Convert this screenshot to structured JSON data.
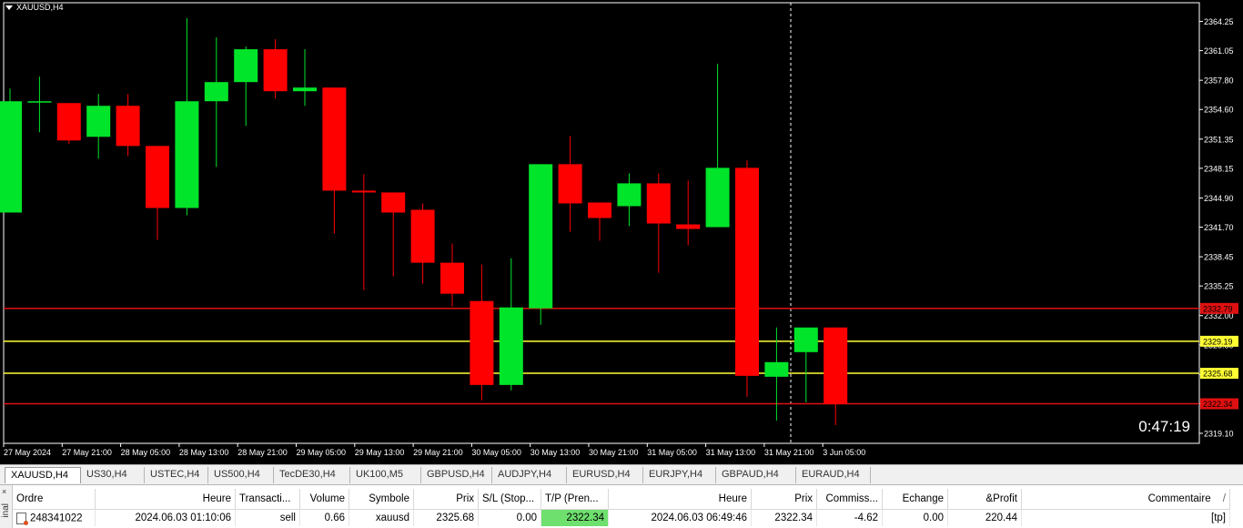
{
  "chart": {
    "symbol_label": "XAUUSD,H4",
    "timer": "0:47:19",
    "colors": {
      "bg": "#000000",
      "bull": "#00e52a",
      "bear": "#ff0000",
      "axis": "#ffffff",
      "sl_line": "#e01010",
      "entry_line": "#ffff33",
      "crosshair": "#ffffff"
    }
  },
  "chart_data": {
    "type": "candlestick",
    "symbol": "XAUUSD",
    "timeframe": "H4",
    "ylim": [
      2318.0,
      2366.3
    ],
    "y_ticks": [
      "2364.25",
      "2361.05",
      "2357.80",
      "2354.60",
      "2351.35",
      "2348.15",
      "2344.90",
      "2341.70",
      "2338.45",
      "2335.25",
      "2332.00",
      "2328.80",
      "2325.55",
      "2322.35",
      "2319.10"
    ],
    "x_labels": [
      "27 May 2024",
      "27 May 21:00",
      "28 May 05:00",
      "28 May 13:00",
      "28 May 21:00",
      "29 May 05:00",
      "29 May 13:00",
      "29 May 21:00",
      "30 May 05:00",
      "30 May 13:00",
      "30 May 21:00",
      "31 May 05:00",
      "31 May 13:00",
      "31 May 21:00",
      "3 Jun 05:00"
    ],
    "candles": [
      {
        "o": 2343.3,
        "h": 2356.9,
        "l": 2343.3,
        "c": 2355.5
      },
      {
        "o": 2355.5,
        "h": 2358.2,
        "l": 2352.1,
        "c": 2355.5
      },
      {
        "o": 2355.3,
        "h": 2355.3,
        "l": 2350.8,
        "c": 2351.2
      },
      {
        "o": 2351.6,
        "h": 2356.3,
        "l": 2349.2,
        "c": 2355.0
      },
      {
        "o": 2355.0,
        "h": 2356.3,
        "l": 2349.5,
        "c": 2350.6
      },
      {
        "o": 2350.6,
        "h": 2350.6,
        "l": 2340.3,
        "c": 2343.8
      },
      {
        "o": 2343.8,
        "h": 2364.6,
        "l": 2343.0,
        "c": 2355.5
      },
      {
        "o": 2355.5,
        "h": 2362.5,
        "l": 2348.3,
        "c": 2357.6
      },
      {
        "o": 2357.6,
        "h": 2361.5,
        "l": 2352.8,
        "c": 2361.2
      },
      {
        "o": 2361.2,
        "h": 2362.3,
        "l": 2355.8,
        "c": 2356.6
      },
      {
        "o": 2356.6,
        "h": 2361.2,
        "l": 2355.0,
        "c": 2357.0
      },
      {
        "o": 2357.0,
        "h": 2357.0,
        "l": 2341.0,
        "c": 2345.7
      },
      {
        "o": 2345.7,
        "h": 2347.5,
        "l": 2334.8,
        "c": 2345.5
      },
      {
        "o": 2345.5,
        "h": 2345.5,
        "l": 2336.3,
        "c": 2343.3
      },
      {
        "o": 2343.6,
        "h": 2344.3,
        "l": 2335.5,
        "c": 2337.8
      },
      {
        "o": 2337.8,
        "h": 2339.9,
        "l": 2333.0,
        "c": 2334.4
      },
      {
        "o": 2333.6,
        "h": 2337.6,
        "l": 2322.7,
        "c": 2324.4
      },
      {
        "o": 2324.4,
        "h": 2338.3,
        "l": 2323.8,
        "c": 2332.9
      },
      {
        "o": 2332.8,
        "h": 2348.6,
        "l": 2331.0,
        "c": 2348.6
      },
      {
        "o": 2348.6,
        "h": 2351.7,
        "l": 2341.2,
        "c": 2344.3
      },
      {
        "o": 2344.4,
        "h": 2344.4,
        "l": 2340.2,
        "c": 2342.7
      },
      {
        "o": 2344.0,
        "h": 2347.6,
        "l": 2341.8,
        "c": 2346.5
      },
      {
        "o": 2346.5,
        "h": 2347.6,
        "l": 2336.7,
        "c": 2342.1
      },
      {
        "o": 2342.0,
        "h": 2346.8,
        "l": 2339.7,
        "c": 2341.5
      },
      {
        "o": 2341.7,
        "h": 2359.6,
        "l": 2341.7,
        "c": 2348.2
      },
      {
        "o": 2348.2,
        "h": 2349.0,
        "l": 2323.1,
        "c": 2325.4
      },
      {
        "o": 2325.3,
        "h": 2330.7,
        "l": 2320.5,
        "c": 2326.9
      },
      {
        "o": 2328.0,
        "h": 2330.5,
        "l": 2322.5,
        "c": 2330.7
      },
      {
        "o": 2330.7,
        "h": 2330.7,
        "l": 2320.0,
        "c": 2322.3
      }
    ],
    "price_lines": [
      {
        "price": 2332.79,
        "label": "2332.79",
        "kind": "stop-loss"
      },
      {
        "price": 2329.19,
        "label": "2329.19",
        "kind": "entry"
      },
      {
        "price": 2325.68,
        "label": "2325.68",
        "kind": "entry"
      },
      {
        "price": 2322.34,
        "label": "2322.34",
        "kind": "take-profit"
      }
    ]
  },
  "tabs": [
    {
      "label": "XAUUSD,H4",
      "active": true
    },
    {
      "label": "US30,H4"
    },
    {
      "label": "USTEC,H4"
    },
    {
      "label": "US500,H4"
    },
    {
      "label": "TecDE30,H4"
    },
    {
      "label": "UK100,M5"
    },
    {
      "label": "GBPUSD,H4"
    },
    {
      "label": "AUDJPY,H4"
    },
    {
      "label": "EURUSD,H4"
    },
    {
      "label": "EURJPY,H4"
    },
    {
      "label": "GBPAUD,H4"
    },
    {
      "label": "EURAUD,H4"
    }
  ],
  "terminal": {
    "side_label": "inal",
    "close_glyph": "×",
    "headers": [
      "Ordre",
      "Heure",
      "Transacti...",
      "Volume",
      "Symbole",
      "Prix",
      "S/L (Stop...",
      "T/P (Pren...",
      "Heure",
      "Prix",
      "Commiss...",
      "Echange",
      "&Profit",
      "Commentaire"
    ],
    "sort_glyph": "/",
    "row": {
      "ordre": "248341022",
      "heure_open": "2024.06.03 01:10:06",
      "type": "sell",
      "volume": "0.66",
      "symbole": "xauusd",
      "prix_open": "2325.68",
      "sl": "0.00",
      "tp": "2322.34",
      "heure_close": "2024.06.03 06:49:46",
      "prix_close": "2322.34",
      "commission": "-4.62",
      "echange": "0.00",
      "profit": "220.44",
      "commentaire": "[tp]"
    }
  }
}
